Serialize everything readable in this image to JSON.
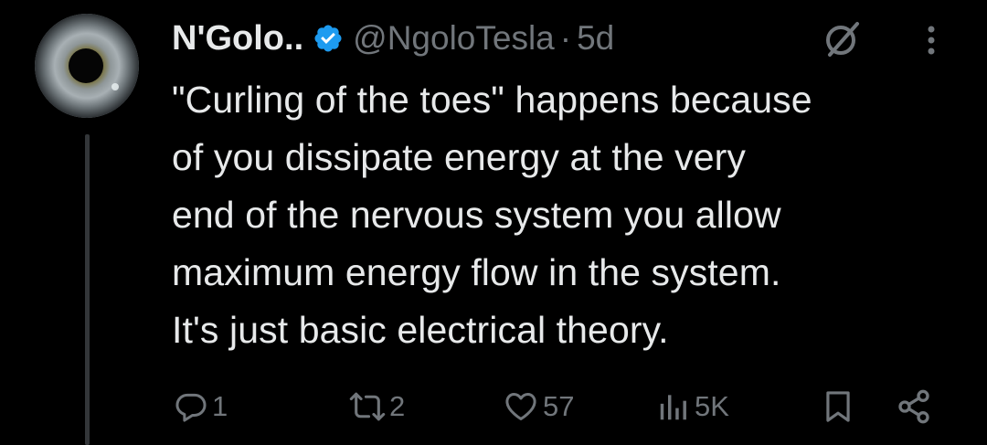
{
  "tweet": {
    "display_name": "N'Golo..",
    "handle": "@NgoloTesla",
    "separator": "·",
    "time": "5d",
    "text_lines": [
      "\"Curling of the toes\" happens because",
      "of you dissipate energy at the very",
      "end of the nervous system you allow",
      "maximum energy flow in the system.",
      "It's just basic electrical theory."
    ]
  },
  "actions": {
    "replies": "1",
    "retweets": "2",
    "likes": "57",
    "views": "5K"
  },
  "icons": {
    "verified": "verified-badge-icon",
    "grok": "grok-icon",
    "more": "more-vertical-icon",
    "reply": "reply-icon",
    "retweet": "retweet-icon",
    "like": "heart-icon",
    "views": "views-chart-icon",
    "bookmark": "bookmark-icon",
    "share": "share-icon"
  },
  "colors": {
    "background": "#000000",
    "text": "#e7e9ea",
    "secondary": "#71767b",
    "verified": "#1d9bf0"
  }
}
